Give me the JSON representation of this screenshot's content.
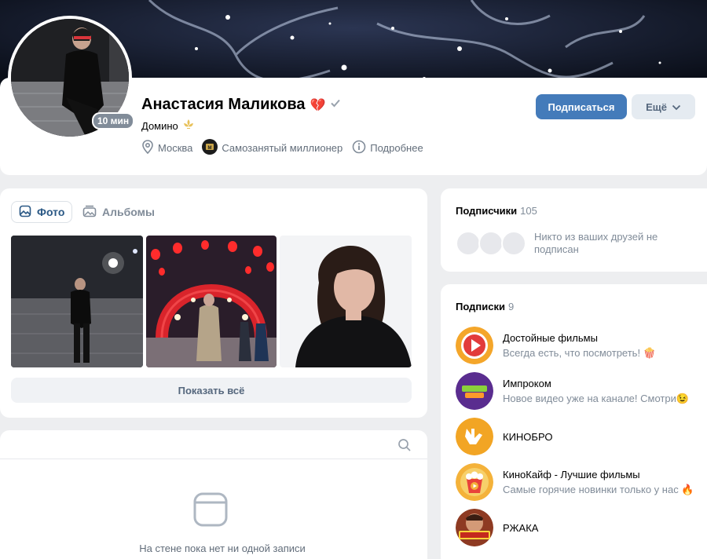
{
  "profile": {
    "name": "Анастасия Маликова",
    "status": "Домино",
    "online": "10 мин",
    "city": "Москва",
    "job": "Самозанятый миллионер",
    "more_info": "Подробнее",
    "heart_emoji": "💔",
    "subscribe_label": "Подписаться",
    "more_label": "Ещё"
  },
  "photos": {
    "tabs": [
      {
        "label": "Фото",
        "active": true
      },
      {
        "label": "Альбомы",
        "active": false
      }
    ],
    "show_all_label": "Показать всё"
  },
  "wall": {
    "empty_text": "На стене пока нет ни одной записи"
  },
  "followers": {
    "title": "Подписчики",
    "count": "105",
    "note": "Никто из ваших друзей не подписан"
  },
  "subscriptions": {
    "title": "Подписки",
    "count": "9",
    "items": [
      {
        "name": "Достойные фильмы",
        "desc": "Всегда есть, что посмотреть! 🍿",
        "icon": "play-icon"
      },
      {
        "name": "Импроком",
        "desc": "Новое видео уже на канале! Смотри😉",
        "icon": "improcom-logo"
      },
      {
        "name": "КИНОБРО",
        "desc": "",
        "icon": "hand-icon"
      },
      {
        "name": "КиноКайф - Лучшие фильмы",
        "desc": "Самые горячие новинки только у нас 🔥",
        "icon": "popcorn-icon"
      },
      {
        "name": "РЖАКА",
        "desc": "",
        "icon": "rzhaka-logo"
      }
    ]
  },
  "colors": {
    "primary": "#447bba",
    "link": "#2a5885",
    "muted": "#818c99",
    "background": "#edeef0"
  }
}
